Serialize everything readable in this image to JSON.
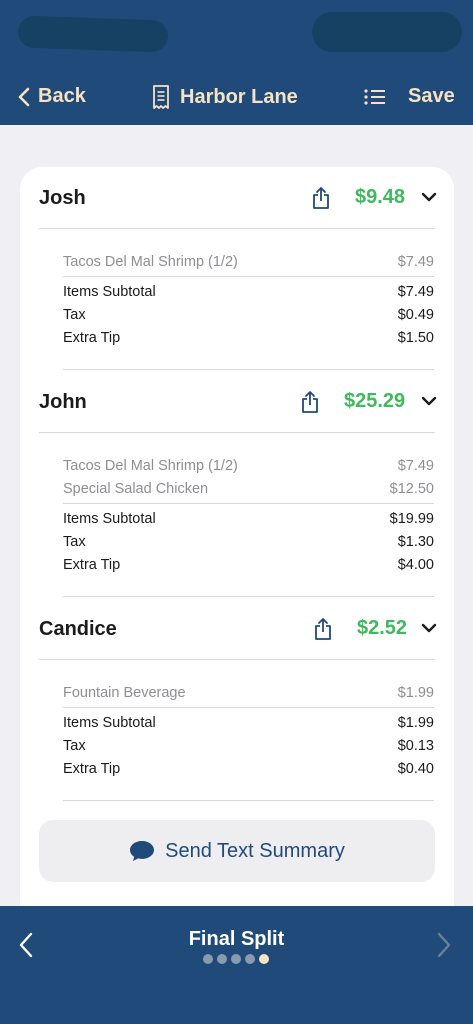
{
  "nav": {
    "back_label": "Back",
    "title": "Harbor Lane",
    "save_label": "Save"
  },
  "people": [
    {
      "name": "Josh",
      "total": "$9.48",
      "items": [
        {
          "label": "Tacos Del Mal Shrimp (1/2)",
          "value": "$7.49"
        }
      ],
      "summary": [
        {
          "label": "Items Subtotal",
          "value": "$7.49"
        },
        {
          "label": "Tax",
          "value": "$0.49"
        },
        {
          "label": "Extra Tip",
          "value": "$1.50"
        }
      ]
    },
    {
      "name": "John",
      "total": "$25.29",
      "items": [
        {
          "label": "Tacos Del Mal Shrimp (1/2)",
          "value": "$7.49"
        },
        {
          "label": "Special Salad Chicken",
          "value": "$12.50"
        }
      ],
      "summary": [
        {
          "label": "Items Subtotal",
          "value": "$19.99"
        },
        {
          "label": "Tax",
          "value": "$1.30"
        },
        {
          "label": "Extra Tip",
          "value": "$4.00"
        }
      ]
    },
    {
      "name": "Candice",
      "total": "$2.52",
      "items": [
        {
          "label": "Fountain Beverage",
          "value": "$1.99"
        }
      ],
      "summary": [
        {
          "label": "Items Subtotal",
          "value": "$1.99"
        },
        {
          "label": "Tax",
          "value": "$0.13"
        },
        {
          "label": "Extra Tip",
          "value": "$0.40"
        }
      ]
    }
  ],
  "send_summary_label": "Send Text Summary",
  "footer": {
    "step_title": "Final Split",
    "total_steps": 5,
    "current_step": 5
  },
  "colors": {
    "nav_background": "#1f4a7a",
    "nav_text": "#f7e3c2",
    "total_green": "#3cba5c",
    "page_background": "#f0eff4"
  },
  "icons": {
    "back": "chevron-left-icon",
    "title": "receipt-icon",
    "list": "list-icon",
    "share": "share-icon",
    "expand": "chevron-down-icon",
    "send": "message-bubble-icon",
    "prev": "chevron-left-icon",
    "next": "chevron-right-icon"
  }
}
